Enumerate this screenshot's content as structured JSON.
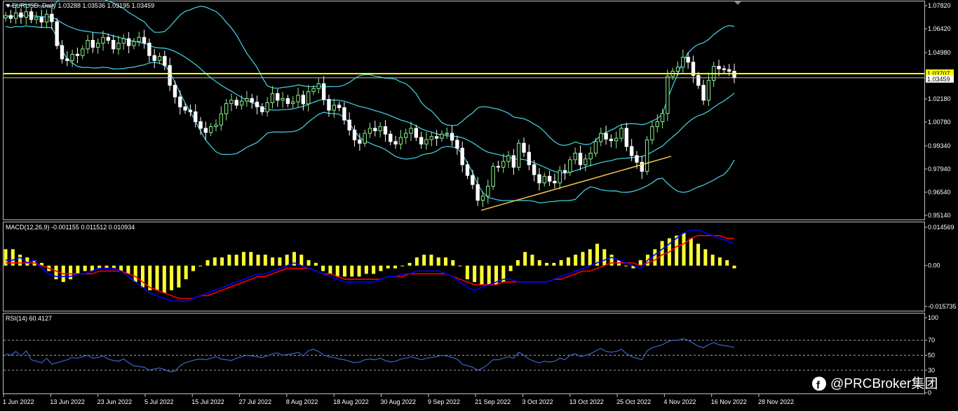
{
  "window": {
    "symbol_header": "EURUSD.,Daily  1.03288 1.03536 1.03195 1.03459",
    "macd_header": "MACD(12,26,9) -0.001155 0.011512 0.010934",
    "rsi_header": "RSI(14) 60.4127"
  },
  "price_axis": {
    "ticks": [
      "1.07820",
      "1.06420",
      "1.04980",
      "1.03707",
      "1.03459",
      "1.02180",
      "1.00780",
      "0.99340",
      "0.97940",
      "0.96540",
      "0.95140"
    ],
    "hline_label": "1.03707",
    "bid_label": "1.03459"
  },
  "macd_axis": {
    "ticks": [
      "0.014569",
      "0.00",
      "-0.015735"
    ]
  },
  "rsi_axis": {
    "ticks": [
      "100",
      "70",
      "50",
      "30",
      "0"
    ]
  },
  "time_axis": {
    "labels": [
      "1 Jun 2022",
      "13 Jun 2022",
      "23 Jun 2022",
      "5 Jul 2022",
      "15 Jul 2022",
      "27 Jul 2022",
      "8 Aug 2022",
      "18 Aug 2022",
      "30 Aug 2022",
      "9 Sep 2022",
      "21 Sep 2022",
      "3 Oct 2022",
      "13 Oct 2022",
      "25 Oct 2022",
      "4 Nov 2022",
      "16 Nov 2022",
      "28 Nov 2022"
    ]
  },
  "watermark": {
    "text": "@PRCBroker集团",
    "icon": "facebook-icon"
  },
  "colors": {
    "background": "#000000",
    "bull": "#90ee90",
    "bear": "#ffffff",
    "bollinger": "#40c8d8",
    "hline": "#ffff00",
    "trendline": "#f5c84a",
    "macd_hist": "#ffff33",
    "macd_line": "#0000ff",
    "signal_line": "#ff0000",
    "rsi_line": "#3c64c8"
  },
  "chart_data": {
    "type": "candlestick",
    "price_scale": {
      "min": 0.9514,
      "max": 1.0782
    },
    "horizontal_line": 1.03707,
    "trendline": {
      "from": 0.9544,
      "to": 0.9871
    },
    "closes": [
      1.0722,
      1.0705,
      1.0738,
      1.0712,
      1.0745,
      1.0698,
      1.0711,
      1.0683,
      1.073,
      1.0685,
      1.054,
      1.046,
      1.045,
      1.0488,
      1.048,
      1.052,
      1.0572,
      1.053,
      1.0555,
      1.059,
      1.0572,
      1.052,
      1.0555,
      1.0582,
      1.054,
      1.0565,
      1.059,
      1.0555,
      1.048,
      1.045,
      1.0475,
      1.042,
      1.03,
      1.023,
      1.017,
      1.015,
      1.014,
      1.008,
      1.004,
      1.0015,
      1.005,
      1.006,
      1.0128,
      1.019,
      1.021,
      1.018,
      1.0205,
      1.022,
      1.0198,
      1.017,
      1.014,
      1.0195,
      1.025,
      1.021,
      1.022,
      1.019,
      1.02,
      1.024,
      1.0188,
      1.0262,
      1.028,
      1.031,
      1.0215,
      1.015,
      1.018,
      1.0165,
      1.009,
      1.003,
      0.997,
      0.995,
      1.001,
      1.004,
      1.0025,
      1.005,
      1.0005,
      0.996,
      0.9945,
      0.9985,
      1.001,
      1.004,
      0.9985,
      0.9945,
      0.9972,
      0.999,
      0.998,
      1.0005,
      1.001,
      0.9968,
      0.992,
      0.982,
      0.9755,
      0.97,
      0.9605,
      0.963,
      0.969,
      0.981,
      0.9805,
      0.984,
      0.9875,
      0.9805,
      0.995,
      0.9895,
      0.982,
      0.976,
      0.971,
      0.975,
      0.972,
      0.971,
      0.9785,
      0.9775,
      0.985,
      0.989,
      0.982,
      0.9855,
      0.989,
      0.996,
      1.001,
      0.9975,
      0.9965,
      0.998,
      1.004,
      0.993,
      0.9875,
      0.9835,
      0.978,
      0.997,
      1.005,
      1.008,
      1.013,
      1.0355,
      1.0385,
      1.041,
      1.047,
      1.044,
      1.036,
      1.03,
      1.021,
      1.033,
      1.0415,
      1.04,
      1.0395,
      1.0385,
      1.0346
    ],
    "rsi": [
      52,
      50,
      55,
      49,
      56,
      44,
      42,
      40,
      46,
      38,
      40,
      42,
      44,
      47,
      46,
      48,
      50,
      46,
      47,
      49,
      45,
      43,
      42,
      45,
      40,
      36,
      35,
      34,
      30,
      32,
      33,
      31,
      28,
      29,
      36,
      40,
      42,
      44,
      45,
      44,
      46,
      48,
      45,
      44,
      43,
      46,
      48,
      50,
      49,
      48,
      47,
      49,
      52,
      53,
      50,
      51,
      52,
      54,
      49,
      56,
      58,
      55,
      50,
      48,
      47,
      45,
      44,
      42,
      40,
      41,
      44,
      45,
      44,
      46,
      43,
      41,
      42,
      45,
      46,
      48,
      46,
      44,
      46,
      47,
      48,
      50,
      49,
      47,
      45,
      38,
      36,
      34,
      30,
      33,
      38,
      44,
      44,
      46,
      48,
      46,
      54,
      50,
      45,
      42,
      40,
      42,
      41,
      42,
      46,
      44,
      50,
      52,
      48,
      50,
      52,
      56,
      59,
      55,
      54,
      55,
      58,
      52,
      48,
      46,
      44,
      56,
      60,
      62,
      64,
      68,
      70,
      70,
      72,
      70,
      66,
      62,
      60,
      64,
      67,
      64,
      63,
      62,
      60.4
    ],
    "macd_scale": {
      "min": -0.015735,
      "max": 0.014569
    },
    "macd": [
      0.002,
      0.002,
      0.003,
      0.001,
      0.002,
      -0.001,
      -0.003,
      -0.004,
      -0.004,
      -0.004,
      -0.003,
      -0.003,
      -0.002,
      -0.001,
      -0.001,
      -0.001,
      -0.002,
      -0.004,
      -0.006,
      -0.008,
      -0.01,
      -0.011,
      -0.012,
      -0.013,
      -0.013,
      -0.013,
      -0.012,
      -0.011,
      -0.01,
      -0.009,
      -0.008,
      -0.007,
      -0.006,
      -0.005,
      -0.004,
      -0.003,
      -0.003,
      -0.002,
      -0.001,
      0.0,
      0.001,
      0.0,
      -0.001,
      -0.002,
      -0.003,
      -0.004,
      -0.005,
      -0.006,
      -0.006,
      -0.006,
      -0.006,
      -0.006,
      -0.005,
      -0.004,
      -0.004,
      -0.003,
      -0.003,
      -0.002,
      -0.002,
      -0.002,
      -0.002,
      -0.003,
      -0.004,
      -0.006,
      -0.008,
      -0.009,
      -0.008,
      -0.007,
      -0.006,
      -0.005,
      -0.005,
      -0.006,
      -0.006,
      -0.006,
      -0.006,
      -0.006,
      -0.005,
      -0.004,
      -0.003,
      -0.002,
      -0.001,
      0.0,
      0.001,
      0.002,
      0.003,
      0.002,
      0.001,
      0.0,
      -0.001,
      0.002,
      0.004,
      0.006,
      0.008,
      0.01,
      0.012,
      0.013,
      0.013,
      0.012,
      0.011,
      0.01,
      0.009,
      0.008
    ],
    "signal": [
      0.001,
      0.001,
      0.001,
      0.001,
      0.001,
      0.0,
      -0.001,
      -0.002,
      -0.003,
      -0.003,
      -0.003,
      -0.003,
      -0.003,
      -0.002,
      -0.002,
      -0.002,
      -0.002,
      -0.003,
      -0.004,
      -0.006,
      -0.008,
      -0.009,
      -0.01,
      -0.011,
      -0.012,
      -0.012,
      -0.012,
      -0.011,
      -0.011,
      -0.01,
      -0.009,
      -0.008,
      -0.007,
      -0.006,
      -0.005,
      -0.004,
      -0.004,
      -0.003,
      -0.002,
      -0.001,
      -0.001,
      -0.001,
      -0.001,
      -0.002,
      -0.003,
      -0.003,
      -0.004,
      -0.005,
      -0.005,
      -0.005,
      -0.005,
      -0.005,
      -0.005,
      -0.004,
      -0.004,
      -0.004,
      -0.003,
      -0.003,
      -0.003,
      -0.003,
      -0.003,
      -0.003,
      -0.004,
      -0.005,
      -0.006,
      -0.007,
      -0.007,
      -0.007,
      -0.007,
      -0.006,
      -0.006,
      -0.006,
      -0.006,
      -0.006,
      -0.006,
      -0.006,
      -0.005,
      -0.005,
      -0.004,
      -0.003,
      -0.002,
      -0.002,
      -0.001,
      0.0,
      0.001,
      0.001,
      0.001,
      0.001,
      0.0,
      0.001,
      0.002,
      0.004,
      0.005,
      0.007,
      0.008,
      0.01,
      0.011,
      0.011,
      0.011,
      0.011,
      0.01,
      0.01
    ],
    "hist": [
      0.006,
      0.006,
      0.004,
      0.003,
      0.002,
      0.001,
      -0.002,
      -0.005,
      -0.006,
      -0.005,
      -0.003,
      -0.002,
      -0.002,
      -0.001,
      -0.001,
      -0.001,
      -0.002,
      -0.003,
      -0.006,
      -0.008,
      -0.009,
      -0.009,
      -0.01,
      -0.009,
      -0.008,
      -0.005,
      -0.002,
      0.0,
      0.002,
      0.003,
      0.003,
      0.004,
      0.004,
      0.005,
      0.005,
      0.004,
      0.004,
      0.003,
      0.003,
      0.004,
      0.005,
      0.004,
      0.002,
      0.001,
      -0.002,
      -0.003,
      -0.004,
      -0.004,
      -0.004,
      -0.004,
      -0.003,
      -0.003,
      -0.002,
      -0.001,
      -0.001,
      0.0,
      0.001,
      0.003,
      0.004,
      0.004,
      0.003,
      0.003,
      0.002,
      0.0,
      -0.005,
      -0.006,
      -0.007,
      -0.007,
      -0.007,
      -0.006,
      -0.002,
      0.002,
      0.005,
      0.004,
      0.002,
      0.001,
      0.001,
      0.002,
      0.003,
      0.004,
      0.005,
      0.006,
      0.008,
      0.006,
      0.004,
      0.002,
      0.0,
      -0.001,
      0.002,
      0.004,
      0.006,
      0.009,
      0.01,
      0.011,
      0.012,
      0.01,
      0.008,
      0.006,
      0.004,
      0.003,
      0.002,
      -0.001
    ]
  }
}
